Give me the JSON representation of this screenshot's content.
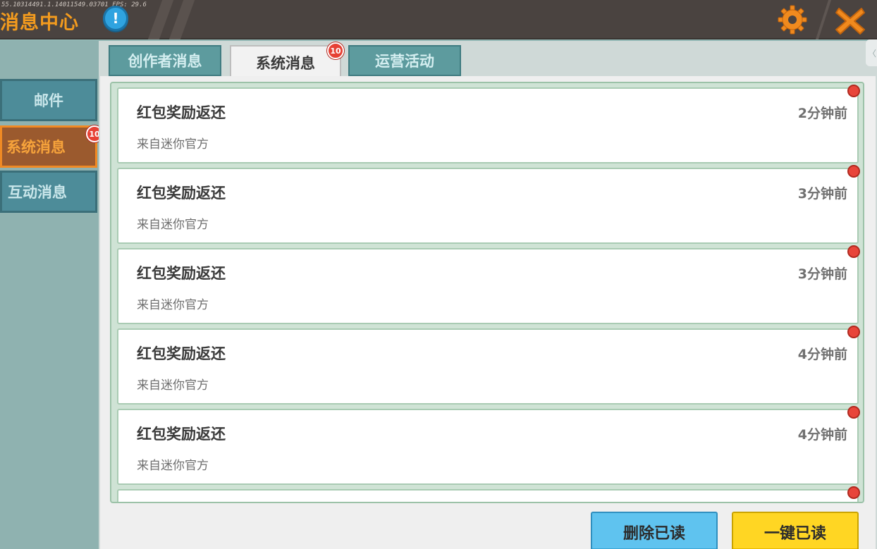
{
  "header": {
    "title": "消息中心",
    "debug_text": "55.10314491.1.14011549.03701 FPS: 29.6",
    "info_glyph": "!",
    "settings_icon": "gear-icon",
    "close_icon": "close-icon",
    "accent_color": "#f39b1e"
  },
  "sidebar": {
    "items": [
      {
        "label": "邮件"
      },
      {
        "label": "系统消息",
        "badge": "10"
      },
      {
        "label": "互动消息"
      }
    ]
  },
  "tabs": [
    {
      "label": "创作者消息"
    },
    {
      "label": "系统消息",
      "badge": "10"
    },
    {
      "label": "运营活动"
    }
  ],
  "messages": [
    {
      "title": "红包奖励返还",
      "source": "来自迷你官方",
      "time": "2分钟前"
    },
    {
      "title": "红包奖励返还",
      "source": "来自迷你官方",
      "time": "3分钟前"
    },
    {
      "title": "红包奖励返还",
      "source": "来自迷你官方",
      "time": "3分钟前"
    },
    {
      "title": "红包奖励返还",
      "source": "来自迷你官方",
      "time": "4分钟前"
    },
    {
      "title": "红包奖励返还",
      "source": "来自迷你官方",
      "time": "4分钟前"
    }
  ],
  "actions": {
    "delete_read": "删除已读",
    "mark_all_read": "一键已读"
  },
  "collapse_glyph": "〈"
}
